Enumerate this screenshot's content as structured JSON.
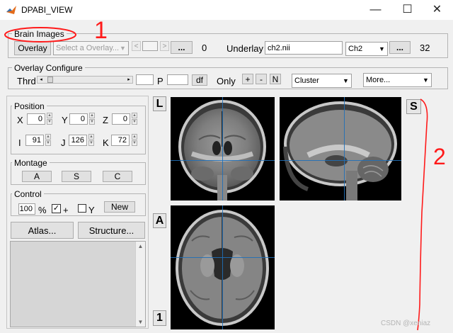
{
  "window": {
    "title": "DPABI_VIEW",
    "controls": {
      "minimize": "—",
      "maximize": "☐",
      "close": "✕"
    }
  },
  "brain_images": {
    "group_title": "Brain Images",
    "overlay_button": "Overlay",
    "overlay_select_placeholder": "Select a Overlay...",
    "prev_glyph": "<",
    "next_glyph": ">",
    "ellipsis": "...",
    "overlay_count": "0",
    "underlay_label": "Underlay",
    "underlay_value": "ch2.nii",
    "underlay_select": "Ch2",
    "underlay_count": "32"
  },
  "overlay_configure": {
    "group_title": "Overlay Configure",
    "thrd_label": "Thrd",
    "p_label": "P",
    "df_button": "df",
    "only_label": "Only",
    "plus": "+",
    "minus": "-",
    "n": "N",
    "cluster_select": "Cluster",
    "more_select": "More..."
  },
  "position": {
    "group_title": "Position",
    "x_label": "X",
    "x_value": "0",
    "y_label": "Y",
    "y_value": "0",
    "z_label": "Z",
    "z_value": "0",
    "i_label": "I",
    "i_value": "91",
    "j_label": "J",
    "j_value": "126",
    "k_label": "K",
    "k_value": "72"
  },
  "montage": {
    "group_title": "Montage",
    "a": "A",
    "s": "S",
    "c": "C"
  },
  "control": {
    "group_title": "Control",
    "percent_value": "100",
    "percent_sign": "%",
    "plus_label": "+",
    "y_label": "Y",
    "new_button": "New"
  },
  "atlas_button": "Atlas...",
  "structure_button": "Structure...",
  "viewer": {
    "left_button": "L",
    "sag_button": "S",
    "ant_button": "A",
    "one_button": "1"
  },
  "annotations": {
    "mark1": "1",
    "mark2": "2"
  },
  "watermark": "CSDN @xeniaz",
  "colors": {
    "crosshair": "#1f6fb8",
    "annotation": "#ff1a1a",
    "panel_bg": "#f0f0f0"
  }
}
